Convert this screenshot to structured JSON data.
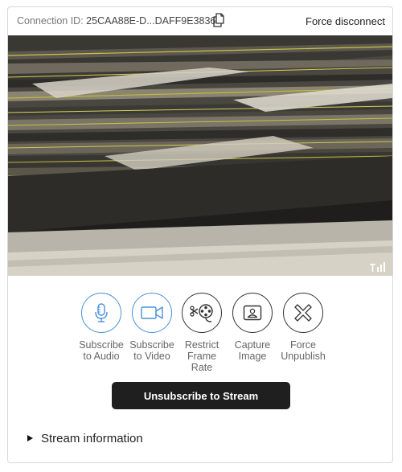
{
  "header": {
    "connection_label": "Connection ID:",
    "connection_id": "25CAA88E-D...DAFF9E3836",
    "copy_icon": "copy-icon",
    "force_disconnect_label": "Force disconnect"
  },
  "video": {
    "signal_icon": "signal-bars-icon"
  },
  "actions": [
    {
      "label": "Subscribe\nto Audio",
      "icon": "microphone-icon",
      "color": "#4a90d9"
    },
    {
      "label": "Subscribe\nto Video",
      "icon": "video-camera-icon",
      "color": "#4a90d9"
    },
    {
      "label": "Restrict\nFrame Rate",
      "icon": "film-reel-icon",
      "color": "#333333"
    },
    {
      "label": "Capture\nImage",
      "icon": "capture-image-icon",
      "color": "#333333"
    },
    {
      "label": "Force\nUnpublish",
      "icon": "close-x-icon",
      "color": "#333333"
    }
  ],
  "unsubscribe_button_label": "Unsubscribe to Stream",
  "stream_information_label": "Stream information"
}
